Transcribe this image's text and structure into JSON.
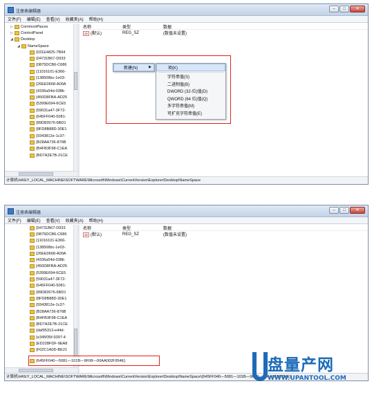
{
  "window_title": "注册表编辑器",
  "window_buttons": {
    "minimize": "–",
    "maximize": "□",
    "close": "✕"
  },
  "menu": [
    "文件(F)",
    "编辑(E)",
    "查看(V)",
    "收藏夹(A)",
    "帮助(H)"
  ],
  "columns": {
    "name": "名称",
    "type": "类型",
    "data": "数据"
  },
  "default_value": {
    "badge": "ab",
    "name": "(默认)",
    "type": "REG_SZ",
    "data": "(数值未设置)"
  },
  "tree1": {
    "parents": [
      {
        "label": "CommonPlaces",
        "arrow": "▷"
      },
      {
        "label": "ControlPanel",
        "arrow": "▷"
      },
      {
        "label": "Desktop",
        "arrow": "◢"
      },
      {
        "label": "NameSpace",
        "arrow": "◢"
      }
    ],
    "keys": [
      "{031E4825-7B94",
      "{04731B67-D933",
      "{0875DCB6-C686",
      "{11016101-E366-",
      "{138508bc-1e03-",
      "{26EE0668-A00A",
      "{4336a54d-038b",
      "{450D8FBA-AD25",
      "{5399E694-6CE5",
      "{59031a47-3F72-",
      "{645FF040-5081-",
      "{89D83576-6BD1",
      "{8FD8B88D-30E1",
      "{9343812e-1c37-",
      "{B28AA736-876B",
      "{B4FB3F98-C1EA",
      "{BD7A2E7B-21CE"
    ]
  },
  "context_menu": {
    "new": "新建(N)",
    "arrow": "▶",
    "submenu": [
      "项(K)",
      "字符串值(S)",
      "二进制值(B)",
      "DWORD (32-位)值(D)",
      "QWORD (64 位)值(Q)",
      "多字符串值(M)",
      "可扩充字符串值(E)"
    ]
  },
  "status1": "计算机\\HKEY_LOCAL_MACHINE\\SOFTWARE\\Microsoft\\Windows\\CurrentVersion\\Explorer\\Desktop\\NameSpace",
  "tree2": {
    "keys": [
      "{04731B67-D933",
      "{0875DCB6-C686",
      "{11016101-E366-",
      "{138508bc-1e03-",
      "{26EE0668-A00A",
      "{4336a54d-038b",
      "{450D8FBA-AD25",
      "{5399E694-6CE5",
      "{59031a47-3F72-",
      "{645FF040-5081-",
      "{89D83576-6BD1",
      "{8FD8B88D-30E1",
      "{9343812e-1c37-",
      "{B28AA736-876B",
      "{B4FB3F98-C1EA",
      "{BD7A2E7B-21CE",
      "{daf95313-e44d-",
      "{e345f35f-9397-4",
      "{ED228FDF-9EA8",
      "{F02C1A0D-BE21"
    ],
    "new_key": "{645FF040—5081—101B—9F08—00AA002F954E}"
  },
  "status2": "计算机\\HKEY_LOCAL_MACHINE\\SOFTWARE\\Microsoft\\Windows\\CurrentVersion\\Explorer\\Desktop\\NameSpace\\{645FF040—5081—101B—9F08—00AA002F954E}",
  "watermark": {
    "name": "盘量产网",
    "url": "WWW.UPANTOOL.COM"
  },
  "colors": {
    "highlight_box": "#e0201b",
    "watermark": "#1e6bb8"
  }
}
